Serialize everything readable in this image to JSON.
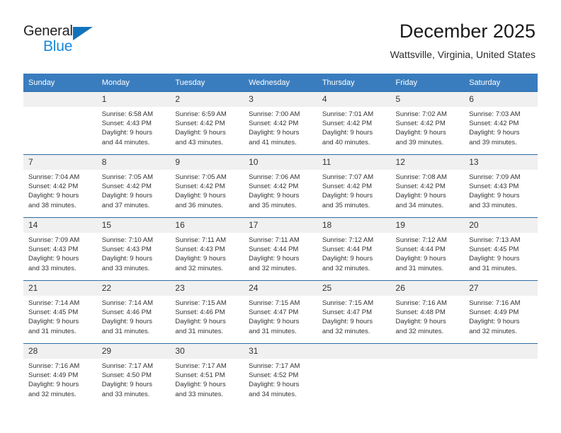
{
  "brand": {
    "name_part1": "General",
    "name_part2": "Blue",
    "accent_color": "#1787dd",
    "logo_triangle_color": "#1273bd"
  },
  "header": {
    "title": "December 2025",
    "subtitle": "Wattsville, Virginia, United States"
  },
  "theme": {
    "header_row_color": "#3a7dbe",
    "row_divider_color": "#2e6da4",
    "daynum_band_color": "#f0f0f0",
    "text_color": "#333333"
  },
  "weekday_headers": [
    "Sunday",
    "Monday",
    "Tuesday",
    "Wednesday",
    "Thursday",
    "Friday",
    "Saturday"
  ],
  "weeks": [
    [
      {
        "day": "",
        "empty": true,
        "sunrise": "",
        "sunset": "",
        "daylight_line1": "",
        "daylight_line2": ""
      },
      {
        "day": "1",
        "sunrise": "Sunrise: 6:58 AM",
        "sunset": "Sunset: 4:43 PM",
        "daylight_line1": "Daylight: 9 hours",
        "daylight_line2": "and 44 minutes."
      },
      {
        "day": "2",
        "sunrise": "Sunrise: 6:59 AM",
        "sunset": "Sunset: 4:42 PM",
        "daylight_line1": "Daylight: 9 hours",
        "daylight_line2": "and 43 minutes."
      },
      {
        "day": "3",
        "sunrise": "Sunrise: 7:00 AM",
        "sunset": "Sunset: 4:42 PM",
        "daylight_line1": "Daylight: 9 hours",
        "daylight_line2": "and 41 minutes."
      },
      {
        "day": "4",
        "sunrise": "Sunrise: 7:01 AM",
        "sunset": "Sunset: 4:42 PM",
        "daylight_line1": "Daylight: 9 hours",
        "daylight_line2": "and 40 minutes."
      },
      {
        "day": "5",
        "sunrise": "Sunrise: 7:02 AM",
        "sunset": "Sunset: 4:42 PM",
        "daylight_line1": "Daylight: 9 hours",
        "daylight_line2": "and 39 minutes."
      },
      {
        "day": "6",
        "sunrise": "Sunrise: 7:03 AM",
        "sunset": "Sunset: 4:42 PM",
        "daylight_line1": "Daylight: 9 hours",
        "daylight_line2": "and 39 minutes."
      }
    ],
    [
      {
        "day": "7",
        "sunrise": "Sunrise: 7:04 AM",
        "sunset": "Sunset: 4:42 PM",
        "daylight_line1": "Daylight: 9 hours",
        "daylight_line2": "and 38 minutes."
      },
      {
        "day": "8",
        "sunrise": "Sunrise: 7:05 AM",
        "sunset": "Sunset: 4:42 PM",
        "daylight_line1": "Daylight: 9 hours",
        "daylight_line2": "and 37 minutes."
      },
      {
        "day": "9",
        "sunrise": "Sunrise: 7:05 AM",
        "sunset": "Sunset: 4:42 PM",
        "daylight_line1": "Daylight: 9 hours",
        "daylight_line2": "and 36 minutes."
      },
      {
        "day": "10",
        "sunrise": "Sunrise: 7:06 AM",
        "sunset": "Sunset: 4:42 PM",
        "daylight_line1": "Daylight: 9 hours",
        "daylight_line2": "and 35 minutes."
      },
      {
        "day": "11",
        "sunrise": "Sunrise: 7:07 AM",
        "sunset": "Sunset: 4:42 PM",
        "daylight_line1": "Daylight: 9 hours",
        "daylight_line2": "and 35 minutes."
      },
      {
        "day": "12",
        "sunrise": "Sunrise: 7:08 AM",
        "sunset": "Sunset: 4:42 PM",
        "daylight_line1": "Daylight: 9 hours",
        "daylight_line2": "and 34 minutes."
      },
      {
        "day": "13",
        "sunrise": "Sunrise: 7:09 AM",
        "sunset": "Sunset: 4:43 PM",
        "daylight_line1": "Daylight: 9 hours",
        "daylight_line2": "and 33 minutes."
      }
    ],
    [
      {
        "day": "14",
        "sunrise": "Sunrise: 7:09 AM",
        "sunset": "Sunset: 4:43 PM",
        "daylight_line1": "Daylight: 9 hours",
        "daylight_line2": "and 33 minutes."
      },
      {
        "day": "15",
        "sunrise": "Sunrise: 7:10 AM",
        "sunset": "Sunset: 4:43 PM",
        "daylight_line1": "Daylight: 9 hours",
        "daylight_line2": "and 33 minutes."
      },
      {
        "day": "16",
        "sunrise": "Sunrise: 7:11 AM",
        "sunset": "Sunset: 4:43 PM",
        "daylight_line1": "Daylight: 9 hours",
        "daylight_line2": "and 32 minutes."
      },
      {
        "day": "17",
        "sunrise": "Sunrise: 7:11 AM",
        "sunset": "Sunset: 4:44 PM",
        "daylight_line1": "Daylight: 9 hours",
        "daylight_line2": "and 32 minutes."
      },
      {
        "day": "18",
        "sunrise": "Sunrise: 7:12 AM",
        "sunset": "Sunset: 4:44 PM",
        "daylight_line1": "Daylight: 9 hours",
        "daylight_line2": "and 32 minutes."
      },
      {
        "day": "19",
        "sunrise": "Sunrise: 7:12 AM",
        "sunset": "Sunset: 4:44 PM",
        "daylight_line1": "Daylight: 9 hours",
        "daylight_line2": "and 31 minutes."
      },
      {
        "day": "20",
        "sunrise": "Sunrise: 7:13 AM",
        "sunset": "Sunset: 4:45 PM",
        "daylight_line1": "Daylight: 9 hours",
        "daylight_line2": "and 31 minutes."
      }
    ],
    [
      {
        "day": "21",
        "sunrise": "Sunrise: 7:14 AM",
        "sunset": "Sunset: 4:45 PM",
        "daylight_line1": "Daylight: 9 hours",
        "daylight_line2": "and 31 minutes."
      },
      {
        "day": "22",
        "sunrise": "Sunrise: 7:14 AM",
        "sunset": "Sunset: 4:46 PM",
        "daylight_line1": "Daylight: 9 hours",
        "daylight_line2": "and 31 minutes."
      },
      {
        "day": "23",
        "sunrise": "Sunrise: 7:15 AM",
        "sunset": "Sunset: 4:46 PM",
        "daylight_line1": "Daylight: 9 hours",
        "daylight_line2": "and 31 minutes."
      },
      {
        "day": "24",
        "sunrise": "Sunrise: 7:15 AM",
        "sunset": "Sunset: 4:47 PM",
        "daylight_line1": "Daylight: 9 hours",
        "daylight_line2": "and 31 minutes."
      },
      {
        "day": "25",
        "sunrise": "Sunrise: 7:15 AM",
        "sunset": "Sunset: 4:47 PM",
        "daylight_line1": "Daylight: 9 hours",
        "daylight_line2": "and 32 minutes."
      },
      {
        "day": "26",
        "sunrise": "Sunrise: 7:16 AM",
        "sunset": "Sunset: 4:48 PM",
        "daylight_line1": "Daylight: 9 hours",
        "daylight_line2": "and 32 minutes."
      },
      {
        "day": "27",
        "sunrise": "Sunrise: 7:16 AM",
        "sunset": "Sunset: 4:49 PM",
        "daylight_line1": "Daylight: 9 hours",
        "daylight_line2": "and 32 minutes."
      }
    ],
    [
      {
        "day": "28",
        "sunrise": "Sunrise: 7:16 AM",
        "sunset": "Sunset: 4:49 PM",
        "daylight_line1": "Daylight: 9 hours",
        "daylight_line2": "and 32 minutes."
      },
      {
        "day": "29",
        "sunrise": "Sunrise: 7:17 AM",
        "sunset": "Sunset: 4:50 PM",
        "daylight_line1": "Daylight: 9 hours",
        "daylight_line2": "and 33 minutes."
      },
      {
        "day": "30",
        "sunrise": "Sunrise: 7:17 AM",
        "sunset": "Sunset: 4:51 PM",
        "daylight_line1": "Daylight: 9 hours",
        "daylight_line2": "and 33 minutes."
      },
      {
        "day": "31",
        "sunrise": "Sunrise: 7:17 AM",
        "sunset": "Sunset: 4:52 PM",
        "daylight_line1": "Daylight: 9 hours",
        "daylight_line2": "and 34 minutes."
      },
      {
        "day": "",
        "empty": true,
        "sunrise": "",
        "sunset": "",
        "daylight_line1": "",
        "daylight_line2": ""
      },
      {
        "day": "",
        "empty": true,
        "sunrise": "",
        "sunset": "",
        "daylight_line1": "",
        "daylight_line2": ""
      },
      {
        "day": "",
        "empty": true,
        "sunrise": "",
        "sunset": "",
        "daylight_line1": "",
        "daylight_line2": ""
      }
    ]
  ]
}
